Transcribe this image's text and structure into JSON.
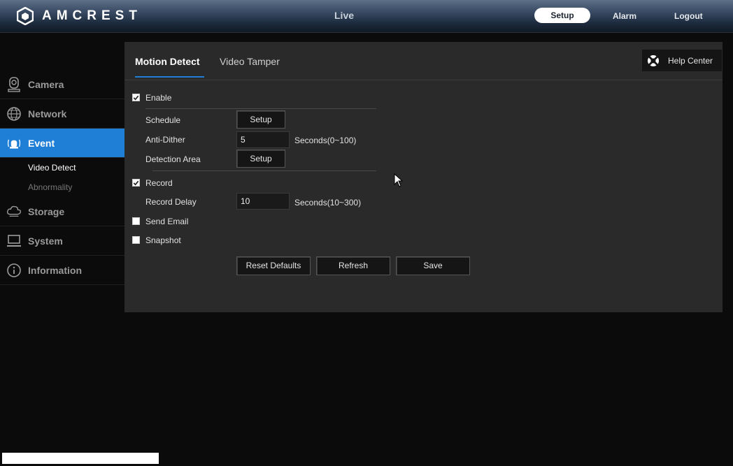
{
  "header": {
    "logo_text": "AMCREST",
    "nav": {
      "live": "Live",
      "setup": "Setup",
      "alarm": "Alarm",
      "logout": "Logout"
    }
  },
  "sidebar": {
    "items": [
      {
        "label": "Camera",
        "icon": "camera-icon"
      },
      {
        "label": "Network",
        "icon": "network-icon"
      },
      {
        "label": "Event",
        "icon": "event-alarm-icon",
        "active": true
      },
      {
        "label": "Storage",
        "icon": "storage-cloud-icon"
      },
      {
        "label": "System",
        "icon": "system-monitor-icon"
      },
      {
        "label": "Information",
        "icon": "info-icon"
      }
    ],
    "event_sub": [
      "Video Detect",
      "Abnormality"
    ]
  },
  "tabs": {
    "active": "Motion Detect",
    "inactive": "Video Tamper"
  },
  "help_center": "Help Center",
  "form": {
    "enable": {
      "label": "Enable",
      "checked": true
    },
    "schedule": {
      "label": "Schedule",
      "button": "Setup"
    },
    "anti_dither": {
      "label": "Anti-Dither",
      "value": "5",
      "unit": "Seconds(0~100)"
    },
    "detection_area": {
      "label": "Detection Area",
      "button": "Setup"
    },
    "record": {
      "label": "Record",
      "checked": true
    },
    "record_delay": {
      "label": "Record Delay",
      "value": "10",
      "unit": "Seconds(10~300)"
    },
    "send_email": {
      "label": "Send Email",
      "checked": false
    },
    "snapshot": {
      "label": "Snapshot",
      "checked": false
    }
  },
  "actions": {
    "reset": "Reset Defaults",
    "refresh": "Refresh",
    "save": "Save"
  },
  "colors": {
    "accent": "#1f7fd6",
    "panel": "#2a2a2a",
    "background": "#0b0b0b"
  }
}
